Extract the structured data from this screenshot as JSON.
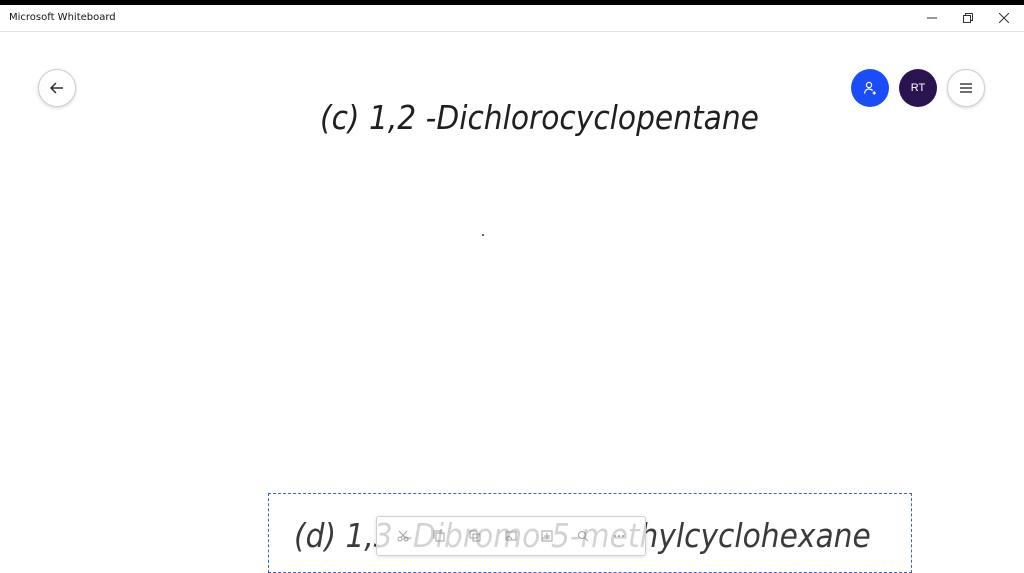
{
  "window": {
    "title": "Microsoft Whiteboard",
    "controls": [
      "minimize-icon",
      "restore-icon",
      "close-icon"
    ]
  },
  "toolbar": {
    "back_icon": "arrow-left-icon",
    "share_icon": "person-share-icon",
    "avatar_initials": "RT",
    "menu_icon": "hamburger-menu-icon"
  },
  "canvas": {
    "note_c": "(c) 1,2 -Dichlorocyclopentane",
    "note_d": "(d) 1,3 -Dibromo-5-methylcyclohexane"
  },
  "context_toolbar": {
    "tools": [
      "cut-icon",
      "copy-icon",
      "duplicate-icon",
      "image-icon",
      "add-icon",
      "zoom-icon",
      "more-icon"
    ]
  },
  "colors": {
    "accent": "#1a4df5",
    "avatar_bg": "#2a1450",
    "selection": "#3a5fd8"
  }
}
